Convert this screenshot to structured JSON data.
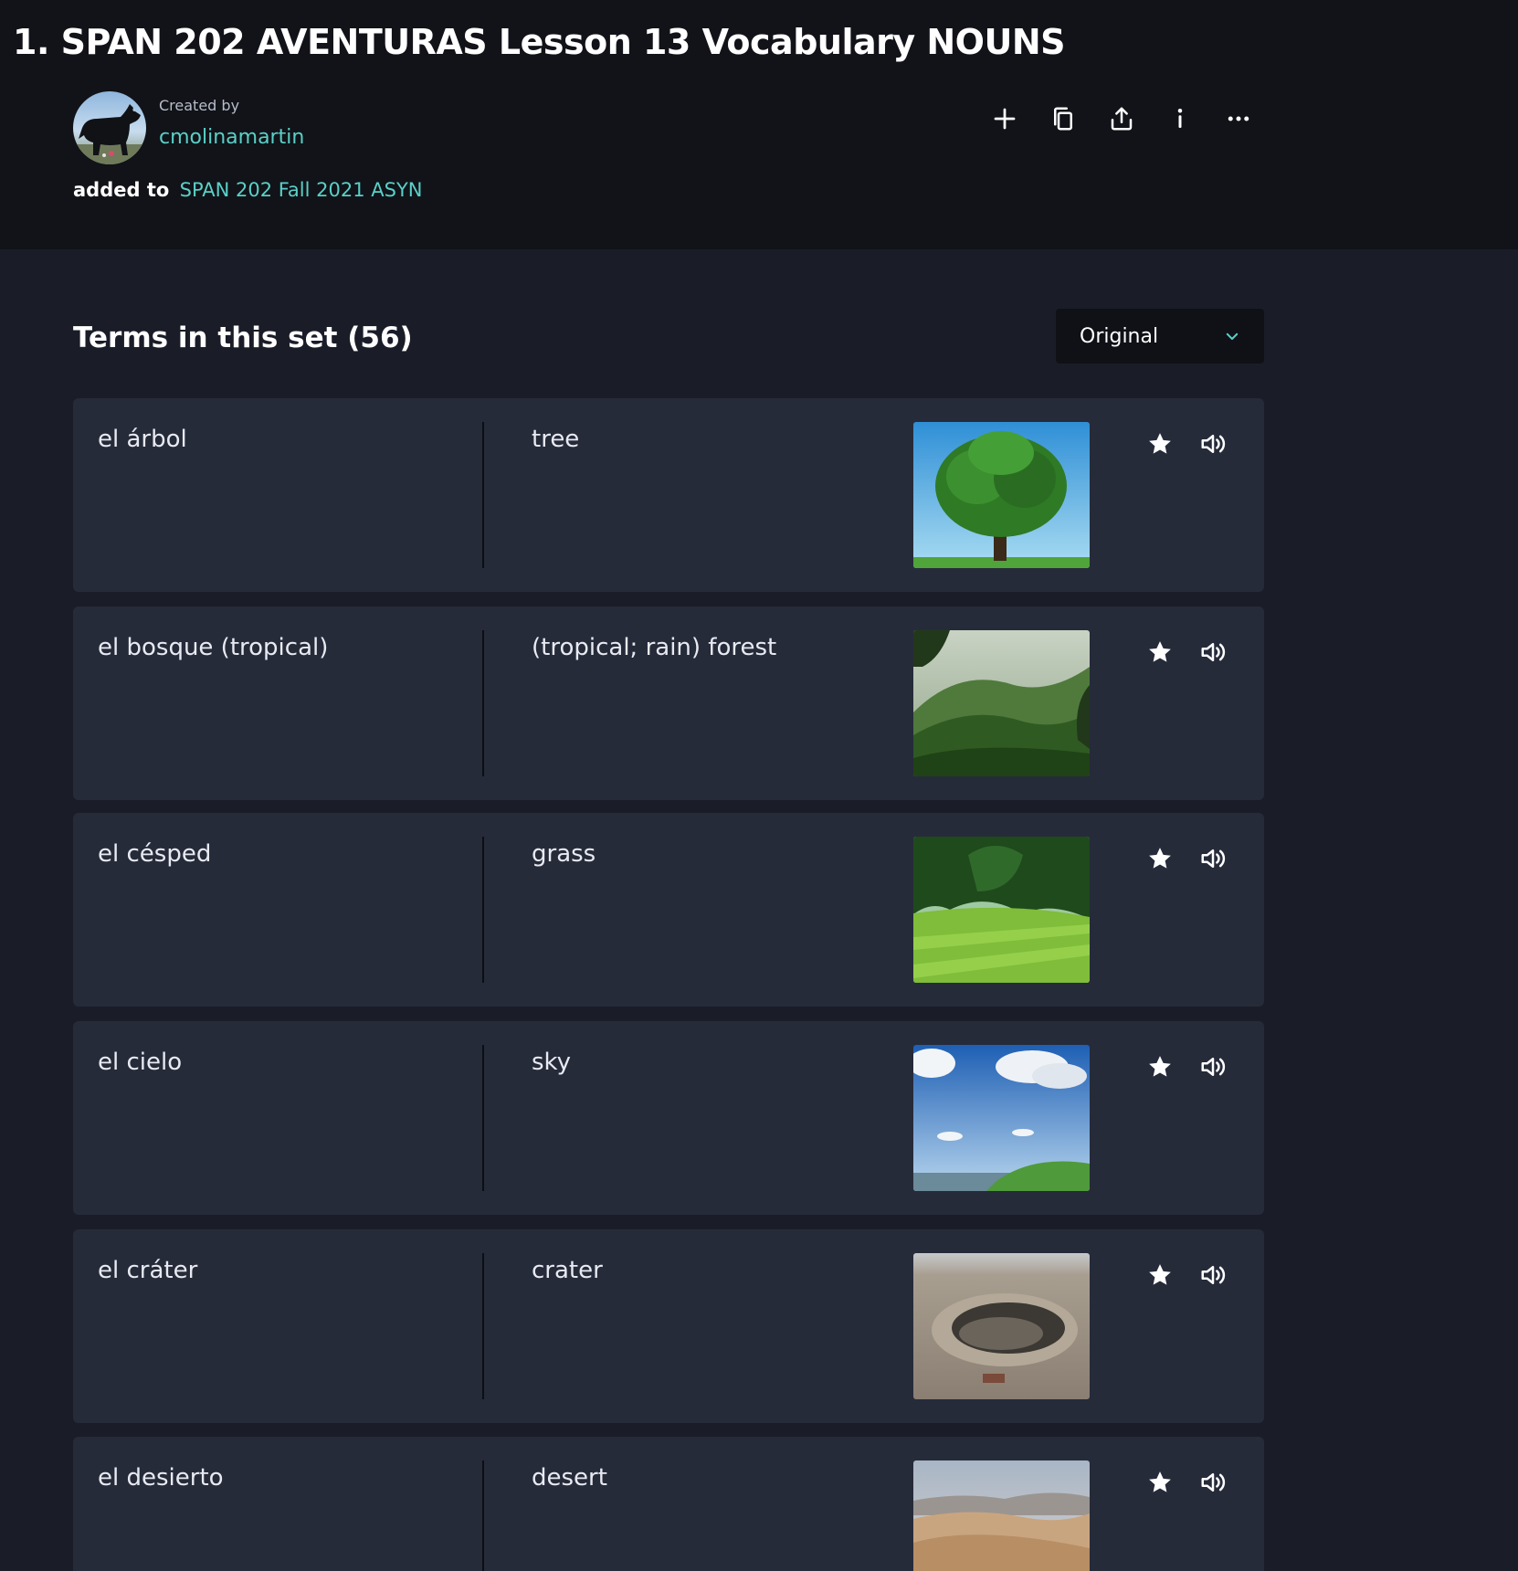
{
  "header": {
    "title": "1. SPAN 202 AVENTURAS Lesson 13 Vocabulary NOUNS"
  },
  "creator": {
    "label": "Created by",
    "name": "cmolinamartin",
    "added_prefix": "added to",
    "folder": "SPAN 202 Fall 2021 ASYN"
  },
  "actions": [
    "plus-icon",
    "copy-icon",
    "share-icon",
    "info-icon",
    "more-icon"
  ],
  "terms": {
    "title": "Terms in this set (56)",
    "sort_value": "Original",
    "items": [
      {
        "term": "el árbol",
        "definition": "tree",
        "image": "tree"
      },
      {
        "term": "el bosque (tropical)",
        "definition": "(tropical; rain) forest",
        "image": "forest"
      },
      {
        "term": "el césped",
        "definition": "grass",
        "image": "grass"
      },
      {
        "term": "el cielo",
        "definition": "sky",
        "image": "sky"
      },
      {
        "term": "el cráter",
        "definition": "crater",
        "image": "crater"
      },
      {
        "term": "el desierto",
        "definition": "desert",
        "image": "desert"
      }
    ]
  },
  "colors": {
    "accent": "#5ad0c8",
    "page_bg": "#1a1d28",
    "header_bg": "#111318",
    "card_bg": "#262b3a"
  }
}
